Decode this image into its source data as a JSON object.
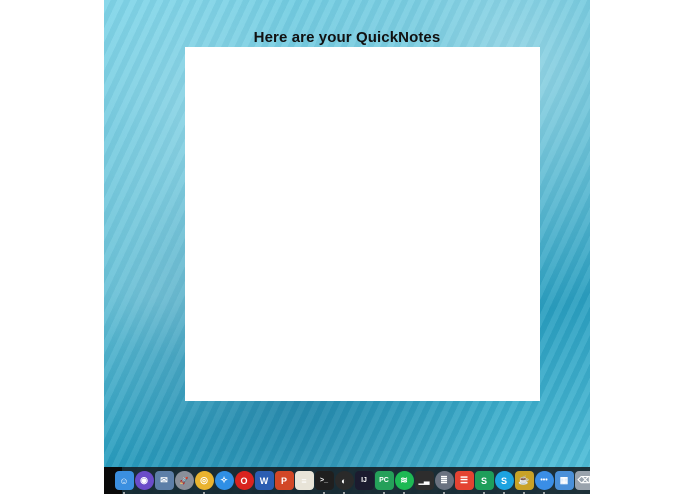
{
  "window": {
    "title": "Here are your QuickNotes"
  },
  "dock": {
    "items": [
      {
        "name": "finder-icon",
        "glyph": "☺",
        "color": "#3b8fe0",
        "running": true
      },
      {
        "name": "siri-icon",
        "glyph": "◉",
        "color": "#6b4cc9",
        "running": false,
        "round": true
      },
      {
        "name": "mail-icon",
        "glyph": "✉",
        "color": "#5d7fa8",
        "running": false
      },
      {
        "name": "launchpad-icon",
        "glyph": "🚀",
        "color": "#8a8f99",
        "running": false,
        "round": true
      },
      {
        "name": "chrome-icon",
        "glyph": "◎",
        "color": "#e9b32f",
        "running": true,
        "round": true
      },
      {
        "name": "safari-icon",
        "glyph": "✧",
        "color": "#2f8fe5",
        "running": false,
        "round": true
      },
      {
        "name": "opera-icon",
        "glyph": "O",
        "color": "#d9231f",
        "running": false,
        "round": true
      },
      {
        "name": "word-icon",
        "glyph": "W",
        "color": "#2b5eb2",
        "running": false
      },
      {
        "name": "powerpoint-icon",
        "glyph": "P",
        "color": "#d24726",
        "running": false
      },
      {
        "name": "notes-icon",
        "glyph": "≡",
        "color": "#e8e4d8",
        "running": false
      },
      {
        "name": "terminal-icon",
        "glyph": ">_",
        "color": "#1f1f1f",
        "running": true
      },
      {
        "name": "github-icon",
        "glyph": "◐",
        "color": "#2a2a2a",
        "running": true,
        "round": true
      },
      {
        "name": "intellij-icon",
        "glyph": "IJ",
        "color": "#1b1b2f",
        "running": false
      },
      {
        "name": "pycharm-icon",
        "glyph": "PC",
        "color": "#25a05a",
        "running": true
      },
      {
        "name": "spotify-icon",
        "glyph": "≋",
        "color": "#1db954",
        "running": true,
        "round": true
      },
      {
        "name": "activity-monitor-icon",
        "glyph": "▁▃",
        "color": "#2d2d2d",
        "running": false
      },
      {
        "name": "database-icon",
        "glyph": "≣",
        "color": "#6a7280",
        "running": true,
        "round": true
      },
      {
        "name": "todoist-icon",
        "glyph": "☰",
        "color": "#e44332",
        "running": false
      },
      {
        "name": "sheets-icon",
        "glyph": "S",
        "color": "#1e9e5a",
        "running": true
      },
      {
        "name": "skype-icon",
        "glyph": "S",
        "color": "#1ca3e0",
        "running": true,
        "round": true
      },
      {
        "name": "coffee-icon",
        "glyph": "☕",
        "color": "#c9a227",
        "running": true
      },
      {
        "name": "messages-icon",
        "glyph": "•••",
        "color": "#3a8ee6",
        "running": true,
        "round": true
      },
      {
        "name": "preview-icon",
        "glyph": "▦",
        "color": "#4a90d9",
        "running": false
      },
      {
        "name": "trash-icon",
        "glyph": "⌫",
        "color": "#9aa3ad",
        "running": false
      }
    ]
  }
}
